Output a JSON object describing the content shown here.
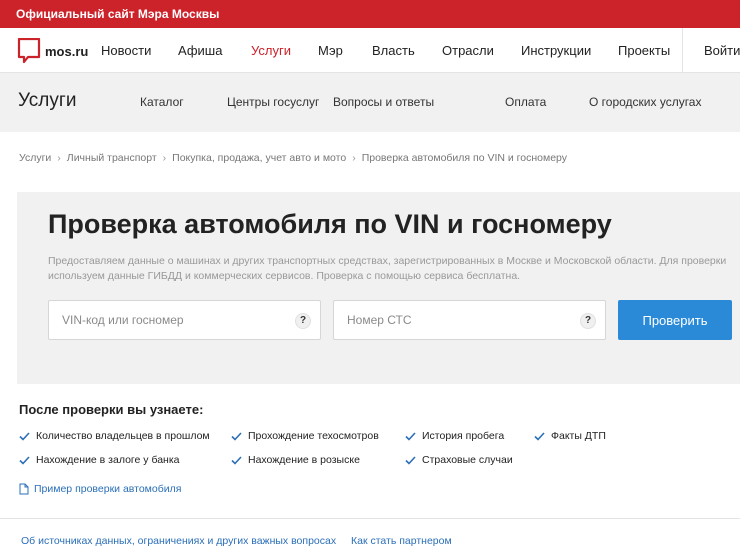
{
  "topbar": {
    "title": "Официальный сайт Мэра Москвы"
  },
  "logo": {
    "text": "mos.ru",
    "icon": "mos-ru-logo-icon"
  },
  "main_nav": {
    "items": [
      {
        "label": "Новости"
      },
      {
        "label": "Афиша"
      },
      {
        "label": "Услуги",
        "active": true
      },
      {
        "label": "Мэр"
      },
      {
        "label": "Власть"
      },
      {
        "label": "Отрасли"
      },
      {
        "label": "Инструкции"
      },
      {
        "label": "Проекты"
      }
    ],
    "login_label": "Войти"
  },
  "sub_nav": {
    "title": "Услуги",
    "items": [
      {
        "label": "Каталог"
      },
      {
        "label": "Центры госуслуг"
      },
      {
        "label": "Вопросы и ответы"
      },
      {
        "label": "Оплата"
      },
      {
        "label": "О городских услугах"
      }
    ]
  },
  "breadcrumb": {
    "items": [
      "Услуги",
      "Личный транспорт",
      "Покупка, продажа, учет авто и мото",
      "Проверка автомобиля по VIN и госномеру"
    ],
    "separator": "›"
  },
  "main": {
    "title": "Проверка автомобиля по VIN и госномеру",
    "description": "Предоставляем данные о машинах и других транспортных средствах, зарегистрированных в Москве и Московской области. Для проверки используем данные ГИБДД и коммерческих сервисов. Проверка с помощью сервиса бесплатна.",
    "vin_field": {
      "placeholder": "VIN-код или госномер",
      "value": "",
      "help": "?"
    },
    "sts_field": {
      "placeholder": "Номер СТС",
      "value": "",
      "help": "?"
    },
    "submit_label": "Проверить"
  },
  "after_check": {
    "title": "После проверки вы узнаете:",
    "features": [
      "Количество владельцев в прошлом",
      "Прохождение техосмотров",
      "История пробега",
      "Факты ДТП",
      "Нахождение в залоге у банка",
      "Нахождение в розыске",
      "Страховые случаи"
    ],
    "sample_link": "Пример проверки автомобиля"
  },
  "footer": {
    "links": [
      "Об источниках данных, ограничениях и других важных вопросах",
      "Как стать партнером"
    ]
  },
  "colors": {
    "brand_red": "#cc2229",
    "button_blue": "#2b8ad8",
    "link_blue": "#2b6fb8",
    "panel_gray": "#f1f1f1"
  }
}
